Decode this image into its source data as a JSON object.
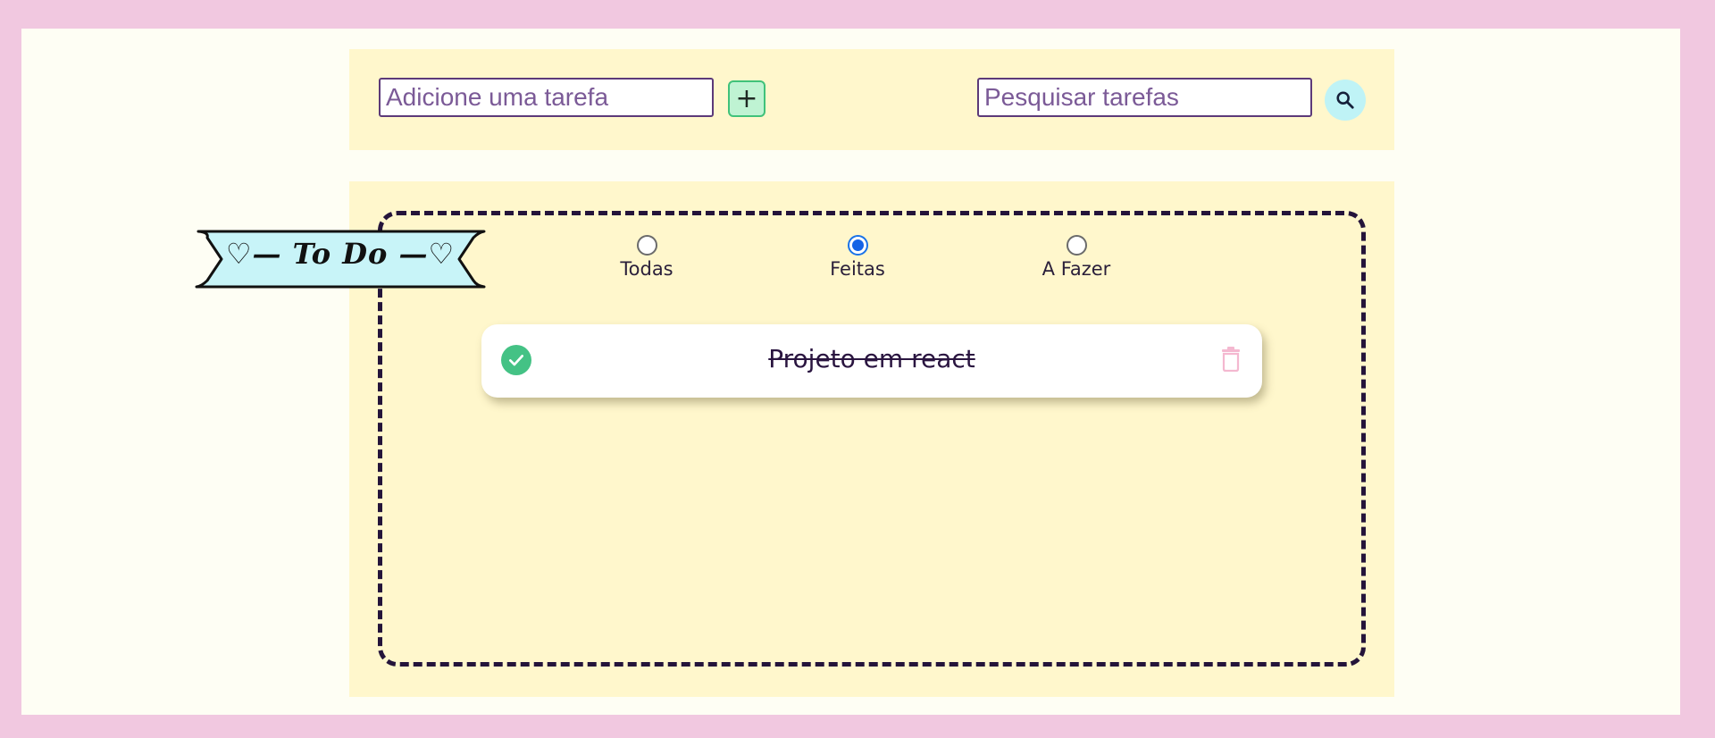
{
  "add_task": {
    "placeholder": "Adicione uma tarefa",
    "button_label": "+"
  },
  "search": {
    "placeholder": "Pesquisar tarefas",
    "icon": "search-icon"
  },
  "banner": {
    "text": "♡— To Do —♡"
  },
  "filters": [
    {
      "label": "Todas",
      "checked": false
    },
    {
      "label": "Feitas",
      "checked": true
    },
    {
      "label": "A Fazer",
      "checked": false
    }
  ],
  "tasks": [
    {
      "text": "Projeto em react",
      "done": true,
      "icons": [
        "check-circle-icon",
        "trash-icon"
      ]
    }
  ],
  "colors": {
    "page_border": "#f1c8e0",
    "panel": "#fff7cc",
    "accent_green": "#44c285",
    "search_button": "#bff3f6",
    "banner_fill": "#c8f4f8",
    "radio_selected": "#1463e6",
    "trash": "#f4b8d0"
  }
}
